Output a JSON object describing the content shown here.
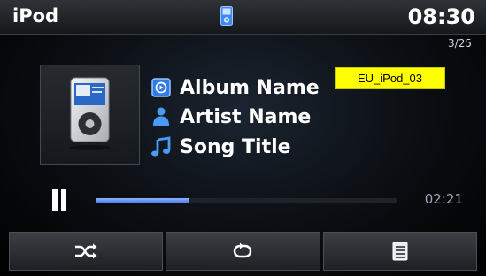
{
  "status_bar": {
    "app_title": "iPod",
    "clock": "08:30",
    "device_icon": "ipod-device-icon"
  },
  "track_counter": "3/25",
  "now_playing": {
    "album_art_icon": "ipod-classic-icon",
    "album_label": "Album Name",
    "album_icon": "album-icon",
    "artist_label": "Artist Name",
    "artist_icon": "artist-person-icon",
    "song_label": "Song Title",
    "song_icon": "music-note-icon"
  },
  "overlay_tag": "EU_iPod_03",
  "playback": {
    "state_icon": "pause-icon",
    "elapsed": "02:21",
    "progress": 0.31
  },
  "controls": [
    {
      "name": "shuffle",
      "icon": "shuffle-icon"
    },
    {
      "name": "repeat",
      "icon": "repeat-icon"
    },
    {
      "name": "list",
      "icon": "list-icon"
    }
  ],
  "colors": {
    "accent": "#3d8bf0",
    "progress_fill": "#5b8cf0",
    "tag_background": "#ffff00"
  }
}
